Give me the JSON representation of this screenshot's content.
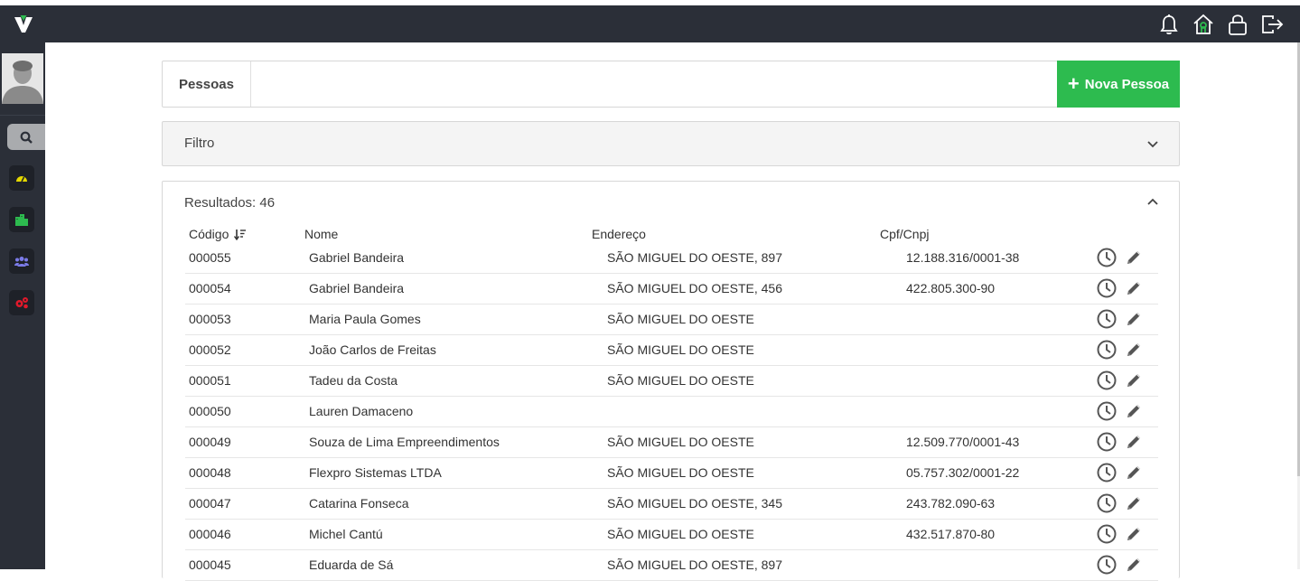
{
  "topbar": {
    "logo_icon": "v-logo-icon",
    "icons": [
      "bell-icon",
      "home-icon",
      "lock-icon",
      "logout-icon"
    ]
  },
  "sidebar": {
    "avatar_icon": "user-avatar",
    "items": [
      {
        "icon": "search-icon",
        "color": "#a9abae"
      },
      {
        "icon": "dashboard-gauge-icon",
        "color": "#e5d800"
      },
      {
        "icon": "buildings-icon",
        "color": "#2dbb4f"
      },
      {
        "icon": "users-group-icon",
        "color": "#7b7be8"
      },
      {
        "icon": "gears-icon",
        "color": "#e0192b"
      }
    ]
  },
  "header": {
    "title": "Pessoas",
    "new_button_label": "Nova Pessoa",
    "new_button_color": "#2dbb4f"
  },
  "filter": {
    "title": "Filtro"
  },
  "results": {
    "title": "Resultados: 46",
    "columns": {
      "code": "Código",
      "name": "Nome",
      "address": "Endereço",
      "document": "Cpf/Cnpj"
    },
    "rows": [
      {
        "code": "000055",
        "name": "Gabriel Bandeira",
        "address": "SÃO MIGUEL DO OESTE, 897",
        "document": "12.188.316/0001-38"
      },
      {
        "code": "000054",
        "name": "Gabriel Bandeira",
        "address": "SÃO MIGUEL DO OESTE, 456",
        "document": "422.805.300-90"
      },
      {
        "code": "000053",
        "name": "Maria Paula Gomes",
        "address": "SÃO MIGUEL DO OESTE",
        "document": ""
      },
      {
        "code": "000052",
        "name": "João Carlos de Freitas",
        "address": "SÃO MIGUEL DO OESTE",
        "document": ""
      },
      {
        "code": "000051",
        "name": "Tadeu da Costa",
        "address": "SÃO MIGUEL DO OESTE",
        "document": ""
      },
      {
        "code": "000050",
        "name": "Lauren Damaceno",
        "address": "",
        "document": ""
      },
      {
        "code": "000049",
        "name": "Souza de Lima Empreendimentos",
        "address": "SÃO MIGUEL DO OESTE",
        "document": "12.509.770/0001-43"
      },
      {
        "code": "000048",
        "name": "Flexpro Sistemas LTDA",
        "address": "SÃO MIGUEL DO OESTE",
        "document": "05.757.302/0001-22"
      },
      {
        "code": "000047",
        "name": "Catarina Fonseca",
        "address": "SÃO MIGUEL DO OESTE, 345",
        "document": "243.782.090-63"
      },
      {
        "code": "000046",
        "name": "Michel Cantú",
        "address": "SÃO MIGUEL DO OESTE",
        "document": "432.517.870-80"
      },
      {
        "code": "000045",
        "name": "Eduarda de Sá",
        "address": "SÃO MIGUEL DO OESTE, 897",
        "document": ""
      }
    ]
  }
}
